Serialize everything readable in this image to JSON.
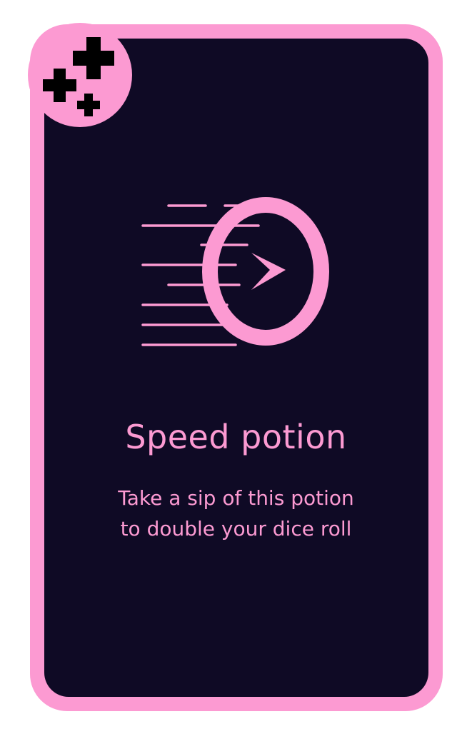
{
  "card": {
    "title": "Speed potion",
    "description_lines": [
      "Take a sip of this potion",
      "to double your dice roll"
    ],
    "badge_icon": "plus-cluster-icon",
    "art_icon": "speed-play-icon"
  },
  "colors": {
    "accent": "#fc9ad2",
    "card_background": "#0f0a25",
    "page_background": "#ffffff",
    "badge_symbol": "#000000"
  }
}
